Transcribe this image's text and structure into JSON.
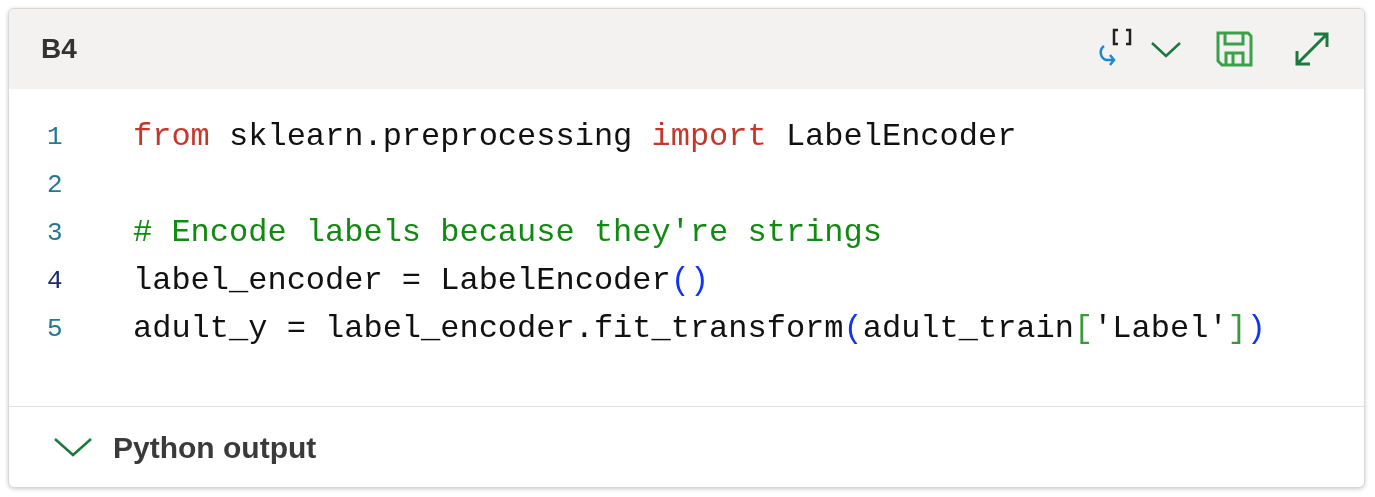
{
  "cell": {
    "title": "B4"
  },
  "code_lines": [
    {
      "number": "1",
      "current": false,
      "tokens": [
        {
          "kind": "keyword",
          "text": "from"
        },
        {
          "kind": "plain",
          "text": " sklearn.preprocessing "
        },
        {
          "kind": "keyword",
          "text": "import"
        },
        {
          "kind": "plain",
          "text": " LabelEncoder"
        }
      ]
    },
    {
      "number": "2",
      "current": false
    },
    {
      "number": "3",
      "current": false,
      "tokens": [
        {
          "kind": "comment",
          "text": "# Encode labels because they're strings"
        }
      ]
    },
    {
      "number": "4",
      "current": true,
      "tokens": [
        {
          "kind": "plain",
          "text": "label_encoder = LabelEncoder"
        },
        {
          "kind": "paren",
          "text": "()"
        }
      ]
    },
    {
      "number": "5",
      "current": false,
      "tokens": [
        {
          "kind": "plain",
          "text": "adult_y = label_encoder.fit_transform"
        },
        {
          "kind": "paren",
          "text": "("
        },
        {
          "kind": "plain",
          "text": "adult_train"
        },
        {
          "kind": "bracket",
          "text": "["
        },
        {
          "kind": "plain",
          "text": "'Label'"
        },
        {
          "kind": "bracket",
          "text": "]"
        },
        {
          "kind": "paren",
          "text": ")"
        }
      ]
    }
  ],
  "output": {
    "label": "Python output",
    "expanded": false
  }
}
